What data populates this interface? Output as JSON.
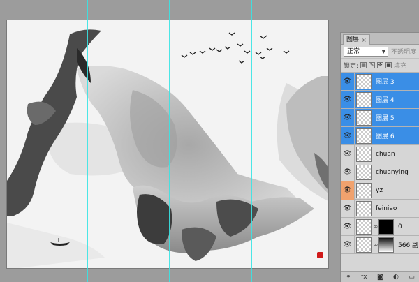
{
  "panel": {
    "tab_label": "图层",
    "tab_close": "×",
    "blend_mode": "正常",
    "opacity_label": "不透明度",
    "lock_label": "锁定:",
    "fill_label": "填充"
  },
  "layers": [
    {
      "name": "图层 3",
      "selected": true
    },
    {
      "name": "图层 4",
      "selected": true
    },
    {
      "name": "图层 5",
      "selected": true
    },
    {
      "name": "图层 6",
      "selected": true
    },
    {
      "name": "chuan",
      "selected": false
    },
    {
      "name": "chuanying",
      "selected": false
    },
    {
      "name": "yz",
      "selected": false
    },
    {
      "name": "feiniao",
      "selected": false
    },
    {
      "name": "0",
      "selected": false
    },
    {
      "name": "566 副",
      "selected": false
    }
  ],
  "footer_icons": [
    "link-icon",
    "fx-icon",
    "mask-icon",
    "adjustment-icon",
    "folder-icon"
  ],
  "footer_glyphs": [
    "⚭",
    "fx",
    "◙",
    "◐",
    "▭"
  ],
  "colors": {
    "selection": "#3a8ee6",
    "guide": "#38e4e4",
    "seal": "#d01a1a",
    "orange_eye": "#f0a26e"
  }
}
